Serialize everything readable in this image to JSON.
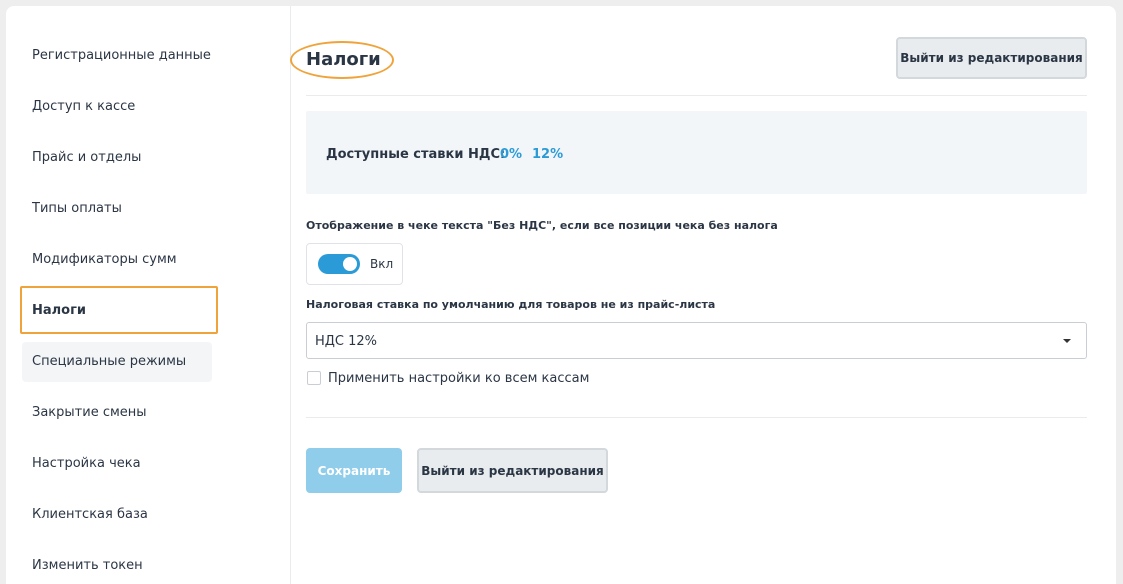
{
  "sidebar": {
    "items": [
      {
        "label": "Регистрационные данные"
      },
      {
        "label": "Доступ к кассе"
      },
      {
        "label": "Прайс и отделы"
      },
      {
        "label": "Типы оплаты"
      },
      {
        "label": "Модификаторы сумм"
      },
      {
        "label": "Налоги"
      },
      {
        "label": "Специальные режимы"
      },
      {
        "label": "Закрытие смены"
      },
      {
        "label": "Настройка чека"
      },
      {
        "label": "Клиентская база"
      },
      {
        "label": "Изменить токен"
      }
    ],
    "active_item": "Налоги"
  },
  "main": {
    "title": "Налоги",
    "exit_edit_top_label": "Выйти из редактирования",
    "vat": {
      "label": "Доступные ставки НДС:",
      "rates": [
        "0%",
        "12%"
      ]
    },
    "no_vat_text": {
      "label": "Отображение в чеке текста \"Без НДС\", если все позиции чека без налога",
      "toggle_state": "on",
      "toggle_label": "Вкл"
    },
    "default_rate": {
      "label": "Налоговая ставка по умолчанию для товаров не из прайс-листа",
      "selected": "НДС 12%"
    },
    "apply_all": {
      "label": "Применить настройки ко всем кассам",
      "checked": false
    },
    "save_label": "Сохранить",
    "exit_edit_bottom_label": "Выйти из редактирования"
  },
  "colors": {
    "accent": "#2a9bd6",
    "highlight": "#f0a33a",
    "primary_disabled": "#8fcdeb"
  }
}
